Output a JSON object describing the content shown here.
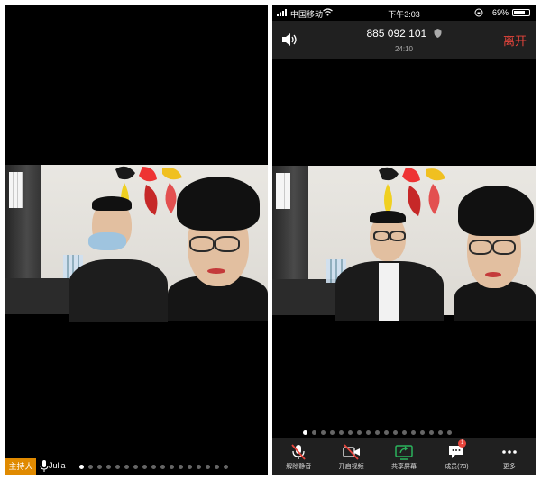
{
  "left_view": {
    "host_badge": "主持人",
    "speaker_name": "Julia",
    "page_dots": 17,
    "active_dot": 0
  },
  "right_view": {
    "status_bar": {
      "carrier": "中国移动",
      "time": "下午3:03",
      "battery": "69%"
    },
    "meeting": {
      "meeting_id": "885 092 101",
      "timer": "24:10",
      "leave_label": "离开"
    },
    "page_dots": 17,
    "active_dot": 0,
    "toolbar": {
      "unmute_label": "解除静音",
      "start_video_label": "开启视频",
      "share_screen_label": "共享屏幕",
      "members_label": "成员(73)",
      "members_badge": "1",
      "more_label": "更多"
    }
  },
  "colors": {
    "host_badge": "#e08a00",
    "leave": "#e8453c",
    "share_icon": "#2bb35c",
    "toolbar_bg": "#202020"
  }
}
